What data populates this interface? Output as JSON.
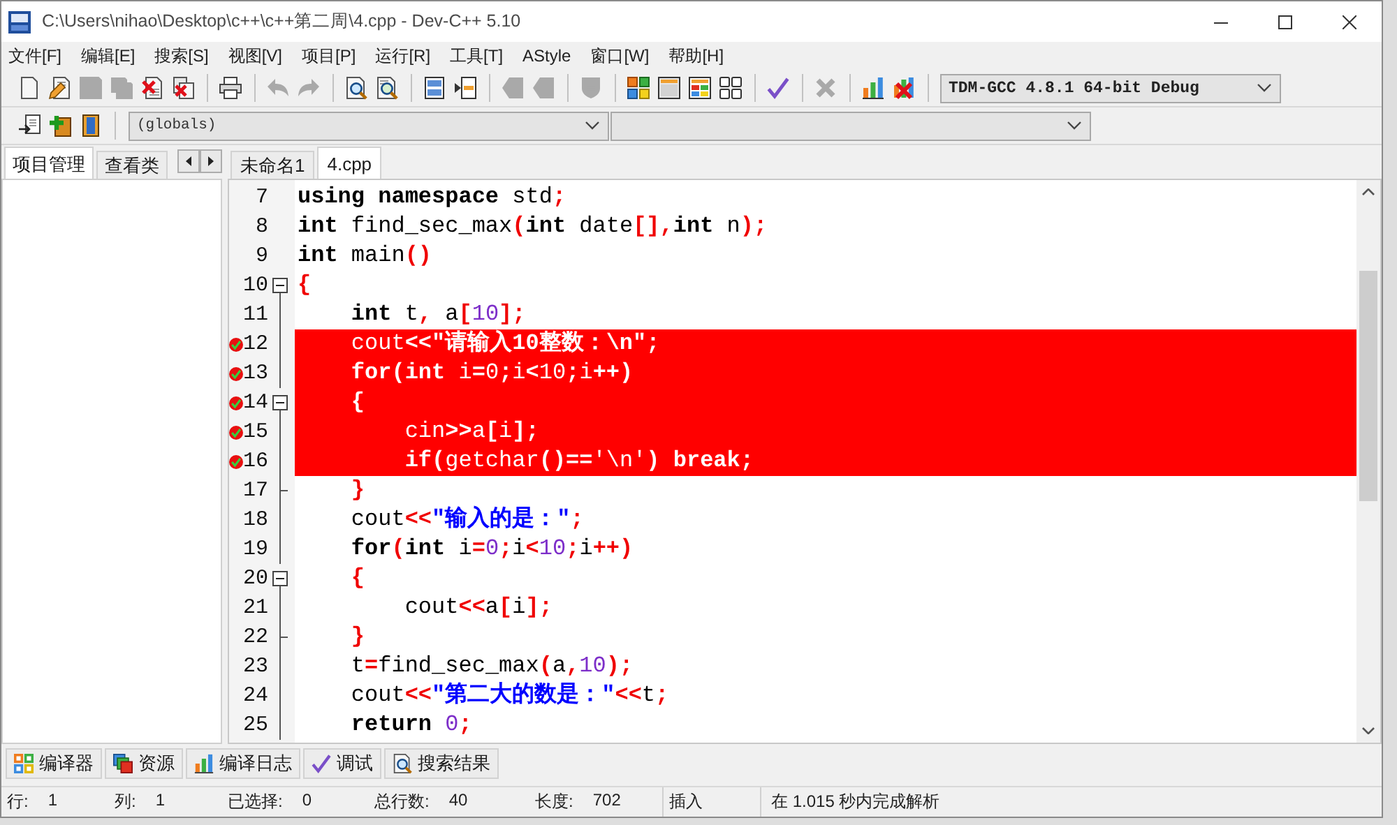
{
  "window": {
    "title": "C:\\Users\\nihao\\Desktop\\c++\\c++第二周\\4.cpp - Dev-C++ 5.10"
  },
  "menu": [
    "文件[F]",
    "编辑[E]",
    "搜索[S]",
    "视图[V]",
    "项目[P]",
    "运行[R]",
    "工具[T]",
    "AStyle",
    "窗口[W]",
    "帮助[H]"
  ],
  "toolbar": {
    "groups": [
      [
        {
          "kind": "new",
          "disabled": false
        },
        {
          "kind": "edit",
          "disabled": false
        },
        {
          "kind": "save",
          "disabled": true
        },
        {
          "kind": "saveall",
          "disabled": true
        },
        {
          "kind": "close",
          "disabled": false
        },
        {
          "kind": "closeall",
          "disabled": false
        }
      ],
      [
        {
          "kind": "print",
          "disabled": false
        }
      ],
      [
        {
          "kind": "undo",
          "disabled": true
        },
        {
          "kind": "redo",
          "disabled": true
        }
      ],
      [
        {
          "kind": "find",
          "disabled": false
        },
        {
          "kind": "replace",
          "disabled": false
        }
      ],
      [
        {
          "kind": "indent",
          "disabled": false
        },
        {
          "kind": "unindent",
          "disabled": false
        }
      ],
      [
        {
          "kind": "bookmarkprev",
          "disabled": true
        },
        {
          "kind": "bookmarknext",
          "disabled": true
        }
      ],
      [
        {
          "kind": "shield",
          "disabled": true
        }
      ],
      [
        {
          "kind": "compile",
          "disabled": false
        },
        {
          "kind": "run",
          "disabled": false
        },
        {
          "kind": "compilerun",
          "disabled": false
        },
        {
          "kind": "rebuild",
          "disabled": false
        }
      ],
      [
        {
          "kind": "syntax",
          "disabled": false
        }
      ],
      [
        {
          "kind": "stop",
          "disabled": true
        }
      ],
      [
        {
          "kind": "profile",
          "disabled": false
        },
        {
          "kind": "deleteprofile",
          "disabled": false
        }
      ]
    ],
    "compiler": "TDM-GCC 4.8.1 64-bit Debug"
  },
  "toolbar2": {
    "scope": "(globals)"
  },
  "left_panel": {
    "tabs": [
      {
        "label": "项目管理",
        "selected": true
      },
      {
        "label": "查看类",
        "selected": false
      }
    ]
  },
  "editor": {
    "tabs": [
      {
        "label": "未命名1",
        "selected": false
      },
      {
        "label": "4.cpp",
        "selected": true
      }
    ],
    "lines": [
      {
        "number": "7",
        "kind": "plain",
        "breakpoint": false,
        "tokens": [
          {
            "kind": "keyword",
            "text": "using namespace"
          },
          {
            "kind": "plain",
            "text": " std"
          },
          {
            "kind": "symbol",
            "text": ";"
          }
        ]
      },
      {
        "number": "8",
        "kind": "plain",
        "breakpoint": false,
        "tokens": [
          {
            "kind": "keyword",
            "text": "int"
          },
          {
            "kind": "plain",
            "text": " find_sec_max"
          },
          {
            "kind": "symbol",
            "text": "("
          },
          {
            "kind": "keyword",
            "text": "int"
          },
          {
            "kind": "plain",
            "text": " date"
          },
          {
            "kind": "symbol",
            "text": "[],"
          },
          {
            "kind": "keyword",
            "text": "int"
          },
          {
            "kind": "plain",
            "text": " n"
          },
          {
            "kind": "symbol",
            "text": ");"
          }
        ]
      },
      {
        "number": "9",
        "kind": "plain",
        "breakpoint": false,
        "tokens": [
          {
            "kind": "keyword",
            "text": "int"
          },
          {
            "kind": "plain",
            "text": " main"
          },
          {
            "kind": "symbol",
            "text": "()"
          }
        ]
      },
      {
        "number": "10",
        "kind": "foldstart",
        "breakpoint": false,
        "tokens": [
          {
            "kind": "symbol",
            "text": "{"
          }
        ]
      },
      {
        "number": "11",
        "kind": "foldbody",
        "breakpoint": false,
        "tokens": [
          {
            "kind": "keyword",
            "text": "    int"
          },
          {
            "kind": "plain",
            "text": " t"
          },
          {
            "kind": "symbol",
            "text": ","
          },
          {
            "kind": "plain",
            "text": " a"
          },
          {
            "kind": "symbol",
            "text": "["
          },
          {
            "kind": "number",
            "text": "10"
          },
          {
            "kind": "symbol",
            "text": "];"
          }
        ]
      },
      {
        "number": "12",
        "kind": "foldbody",
        "breakpoint": true,
        "tokens": [
          {
            "kind": "plain",
            "text": "    cout"
          },
          {
            "kind": "symbol",
            "text": "<<"
          },
          {
            "kind": "string",
            "text": "\"请输入10整数：\\n\""
          },
          {
            "kind": "symbol",
            "text": ";"
          }
        ]
      },
      {
        "number": "13",
        "kind": "foldbody",
        "breakpoint": true,
        "tokens": [
          {
            "kind": "keyword",
            "text": "    for"
          },
          {
            "kind": "symbol",
            "text": "("
          },
          {
            "kind": "keyword",
            "text": "int"
          },
          {
            "kind": "plain",
            "text": " i"
          },
          {
            "kind": "symbol",
            "text": "="
          },
          {
            "kind": "number",
            "text": "0"
          },
          {
            "kind": "symbol",
            "text": ";"
          },
          {
            "kind": "plain",
            "text": "i"
          },
          {
            "kind": "symbol",
            "text": "<"
          },
          {
            "kind": "number",
            "text": "10"
          },
          {
            "kind": "symbol",
            "text": ";"
          },
          {
            "kind": "plain",
            "text": "i"
          },
          {
            "kind": "symbol",
            "text": "++)"
          }
        ]
      },
      {
        "number": "14",
        "kind": "foldstart",
        "breakpoint": true,
        "tokens": [
          {
            "kind": "symbol",
            "text": "    {"
          }
        ]
      },
      {
        "number": "15",
        "kind": "foldbody",
        "breakpoint": true,
        "tokens": [
          {
            "kind": "plain",
            "text": "        cin"
          },
          {
            "kind": "symbol",
            "text": ">>"
          },
          {
            "kind": "plain",
            "text": "a"
          },
          {
            "kind": "symbol",
            "text": "["
          },
          {
            "kind": "plain",
            "text": "i"
          },
          {
            "kind": "symbol",
            "text": "];"
          }
        ]
      },
      {
        "number": "16",
        "kind": "foldbody",
        "breakpoint": true,
        "tokens": [
          {
            "kind": "keyword",
            "text": "        if"
          },
          {
            "kind": "symbol",
            "text": "("
          },
          {
            "kind": "plain",
            "text": "getchar"
          },
          {
            "kind": "symbol",
            "text": "()=="
          },
          {
            "kind": "char",
            "text": "'\\n'"
          },
          {
            "kind": "symbol",
            "text": ")"
          },
          {
            "kind": "keyword",
            "text": " break"
          },
          {
            "kind": "symbol",
            "text": ";"
          }
        ]
      },
      {
        "number": "17",
        "kind": "foldend",
        "breakpoint": false,
        "tokens": [
          {
            "kind": "symbol",
            "text": "    }"
          }
        ]
      },
      {
        "number": "18",
        "kind": "foldbody",
        "breakpoint": false,
        "tokens": [
          {
            "kind": "plain",
            "text": "    cout"
          },
          {
            "kind": "symbol",
            "text": "<<"
          },
          {
            "kind": "string",
            "text": "\"输入的是：\""
          },
          {
            "kind": "symbol",
            "text": ";"
          }
        ]
      },
      {
        "number": "19",
        "kind": "foldbody",
        "breakpoint": false,
        "tokens": [
          {
            "kind": "keyword",
            "text": "    for"
          },
          {
            "kind": "symbol",
            "text": "("
          },
          {
            "kind": "keyword",
            "text": "int"
          },
          {
            "kind": "plain",
            "text": " i"
          },
          {
            "kind": "symbol",
            "text": "="
          },
          {
            "kind": "number",
            "text": "0"
          },
          {
            "kind": "symbol",
            "text": ";"
          },
          {
            "kind": "plain",
            "text": "i"
          },
          {
            "kind": "symbol",
            "text": "<"
          },
          {
            "kind": "number",
            "text": "10"
          },
          {
            "kind": "symbol",
            "text": ";"
          },
          {
            "kind": "plain",
            "text": "i"
          },
          {
            "kind": "symbol",
            "text": "++)"
          }
        ]
      },
      {
        "number": "20",
        "kind": "foldstart",
        "breakpoint": false,
        "tokens": [
          {
            "kind": "symbol",
            "text": "    {"
          }
        ]
      },
      {
        "number": "21",
        "kind": "foldbody",
        "breakpoint": false,
        "tokens": [
          {
            "kind": "plain",
            "text": "        cout"
          },
          {
            "kind": "symbol",
            "text": "<<"
          },
          {
            "kind": "plain",
            "text": "a"
          },
          {
            "kind": "symbol",
            "text": "["
          },
          {
            "kind": "plain",
            "text": "i"
          },
          {
            "kind": "symbol",
            "text": "];"
          }
        ]
      },
      {
        "number": "22",
        "kind": "foldend",
        "breakpoint": false,
        "tokens": [
          {
            "kind": "symbol",
            "text": "    }"
          }
        ]
      },
      {
        "number": "23",
        "kind": "foldbody",
        "breakpoint": false,
        "tokens": [
          {
            "kind": "plain",
            "text": "    t"
          },
          {
            "kind": "symbol",
            "text": "="
          },
          {
            "kind": "plain",
            "text": "find_sec_max"
          },
          {
            "kind": "symbol",
            "text": "("
          },
          {
            "kind": "plain",
            "text": "a"
          },
          {
            "kind": "symbol",
            "text": ","
          },
          {
            "kind": "number",
            "text": "10"
          },
          {
            "kind": "symbol",
            "text": ");"
          }
        ]
      },
      {
        "number": "24",
        "kind": "foldbody",
        "breakpoint": false,
        "tokens": [
          {
            "kind": "plain",
            "text": "    cout"
          },
          {
            "kind": "symbol",
            "text": "<<"
          },
          {
            "kind": "string",
            "text": "\"第二大的数是：\""
          },
          {
            "kind": "symbol",
            "text": "<<"
          },
          {
            "kind": "plain",
            "text": "t"
          },
          {
            "kind": "symbol",
            "text": ";"
          }
        ]
      },
      {
        "number": "25",
        "kind": "foldbody",
        "breakpoint": false,
        "tokens": [
          {
            "kind": "keyword",
            "text": "    return"
          },
          {
            "kind": "number",
            "text": " 0"
          },
          {
            "kind": "symbol",
            "text": ";"
          }
        ]
      }
    ]
  },
  "bottom_tabs": [
    {
      "kind": "compiler",
      "label": "编译器",
      "selected": false
    },
    {
      "kind": "resources",
      "label": "资源",
      "selected": false
    },
    {
      "kind": "log",
      "label": "编译日志",
      "selected": false
    },
    {
      "kind": "debug",
      "label": "调试",
      "selected": false
    },
    {
      "kind": "search",
      "label": "搜索结果",
      "selected": false
    }
  ],
  "status_bar": {
    "fields": [
      {
        "label": "行:",
        "value": "1"
      },
      {
        "label": "列:",
        "value": "1"
      },
      {
        "label": "已选择:",
        "value": "0"
      },
      {
        "label": "总行数:",
        "value": "40"
      },
      {
        "label": "长度:",
        "value": "702"
      }
    ],
    "mode": "插入",
    "message": "在 1.015 秒内完成解析"
  }
}
